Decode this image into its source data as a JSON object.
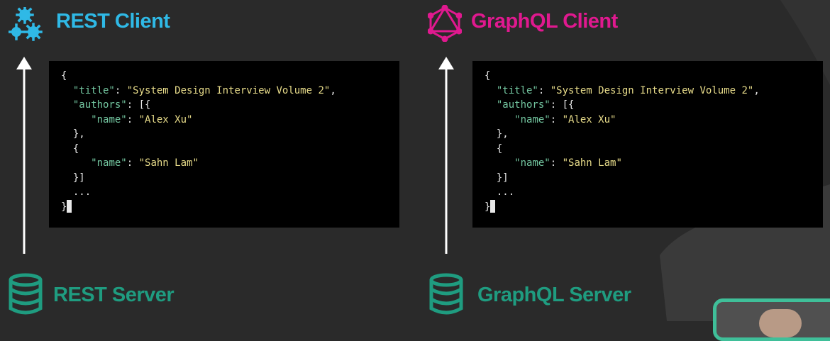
{
  "rest": {
    "client_title": "REST Client",
    "server_title": "REST Server",
    "client_icon": "gears-icon",
    "server_icon": "database-icon",
    "client_color": "#2fb9e6",
    "server_color": "#1f9c80",
    "code": [
      {
        "indent": "",
        "key": "",
        "text": "{"
      },
      {
        "indent": "  ",
        "key": "\"title\"",
        "text": ": ",
        "value": "\"System Design Interview Volume 2\"",
        "tail": ","
      },
      {
        "indent": "  ",
        "key": "\"authors\"",
        "text": ": [{"
      },
      {
        "indent": "     ",
        "key": "\"name\"",
        "text": ": ",
        "value": "\"Alex Xu\""
      },
      {
        "indent": "  ",
        "key": "",
        "text": "},"
      },
      {
        "indent": "  ",
        "key": "",
        "text": "{"
      },
      {
        "indent": "     ",
        "key": "\"name\"",
        "text": ": ",
        "value": "\"Sahn Lam\""
      },
      {
        "indent": "  ",
        "key": "",
        "text": "}]"
      },
      {
        "indent": "  ",
        "key": "",
        "text": "..."
      },
      {
        "indent": "",
        "key": "",
        "text": "}",
        "cursor": true
      }
    ]
  },
  "graphql": {
    "client_title": "GraphQL Client",
    "server_title": "GraphQL Server",
    "client_icon": "graphql-logo-icon",
    "server_icon": "database-icon",
    "client_color": "#e0198f",
    "server_color": "#1f9c80",
    "code": [
      {
        "indent": "",
        "key": "",
        "text": "{"
      },
      {
        "indent": "  ",
        "key": "\"title\"",
        "text": ": ",
        "value": "\"System Design Interview Volume 2\"",
        "tail": ","
      },
      {
        "indent": "  ",
        "key": "\"authors\"",
        "text": ": [{"
      },
      {
        "indent": "     ",
        "key": "\"name\"",
        "text": ": ",
        "value": "\"Alex Xu\""
      },
      {
        "indent": "  ",
        "key": "",
        "text": "},"
      },
      {
        "indent": "  ",
        "key": "",
        "text": "{"
      },
      {
        "indent": "     ",
        "key": "\"name\"",
        "text": ": ",
        "value": "\"Sahn Lam\""
      },
      {
        "indent": "  ",
        "key": "",
        "text": "}]"
      },
      {
        "indent": "  ",
        "key": "",
        "text": "..."
      },
      {
        "indent": "",
        "key": "",
        "text": "}",
        "cursor": true
      }
    ]
  }
}
